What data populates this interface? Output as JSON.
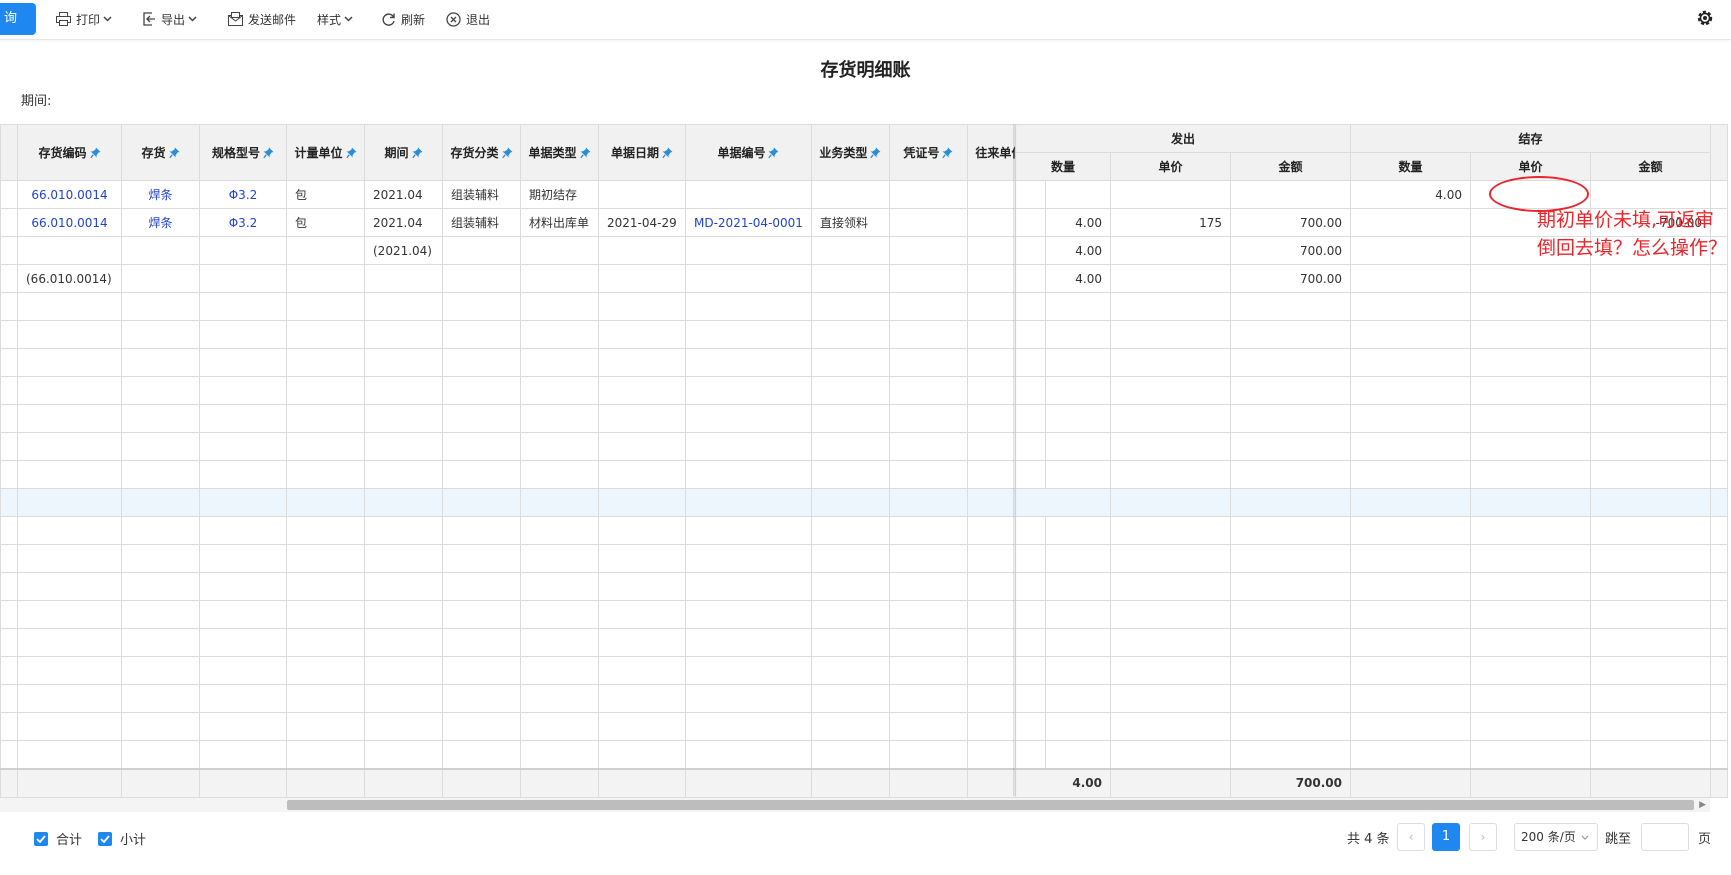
{
  "toolbar": {
    "query_label": "询",
    "print_label": "打印",
    "export_label": "导出",
    "email_label": "发送邮件",
    "style_label": "样式",
    "refresh_label": "刷新",
    "exit_label": "退出"
  },
  "report": {
    "title": "存货明细账",
    "period_label": "期间:"
  },
  "left_headers": [
    "存货编码",
    "存货",
    "规格型号",
    "计量单位",
    "期间",
    "存货分类",
    "单据类型",
    "单据日期",
    "单据编号",
    "业务类型",
    "凭证号",
    "往来单位"
  ],
  "left_rows": [
    [
      "66.010.0014",
      "焊条",
      "Φ3.2",
      "包",
      "2021.04",
      "组装辅料",
      "期初结存",
      "",
      "",
      "",
      "",
      ""
    ],
    [
      "66.010.0014",
      "焊条",
      "Φ3.2",
      "包",
      "2021.04",
      "组装辅料",
      "材料出库单",
      "2021-04-29",
      "MD-2021-04-0001",
      "直接领料",
      "",
      ""
    ],
    [
      "",
      "",
      "",
      "",
      "(2021.04)",
      "",
      "",
      "",
      "",
      "",
      "",
      ""
    ],
    [
      "(66.010.0014)",
      "",
      "",
      "",
      "",
      "",
      "",
      "",
      "",
      "",
      "",
      ""
    ]
  ],
  "right_groups": [
    "发出",
    "结存"
  ],
  "right_headers": [
    "数量",
    "单价",
    "金额",
    "数量",
    "单价",
    "金额"
  ],
  "right_rows": [
    [
      "",
      "",
      "",
      "4.00",
      "",
      ""
    ],
    [
      "4.00",
      "175",
      "700.00",
      "",
      "",
      "-700.00"
    ],
    [
      "4.00",
      "",
      "700.00",
      "",
      "",
      ""
    ],
    [
      "4.00",
      "",
      "700.00",
      "",
      "",
      ""
    ]
  ],
  "totals": [
    "4.00",
    "",
    "700.00",
    "",
    "",
    ""
  ],
  "footer": {
    "total_label": "合计",
    "subtotal_label": "小计",
    "count_text": "共 4 条",
    "current_page": "1",
    "page_size": "200 条/页",
    "jump_label": "跳至",
    "page_unit": "页"
  },
  "annotation": {
    "note": "期初单价未填,可返审倒回去填？怎么操作？"
  },
  "colors": {
    "primary": "#1e88f0",
    "link": "#2244cc",
    "annotation": "#e8262c"
  }
}
